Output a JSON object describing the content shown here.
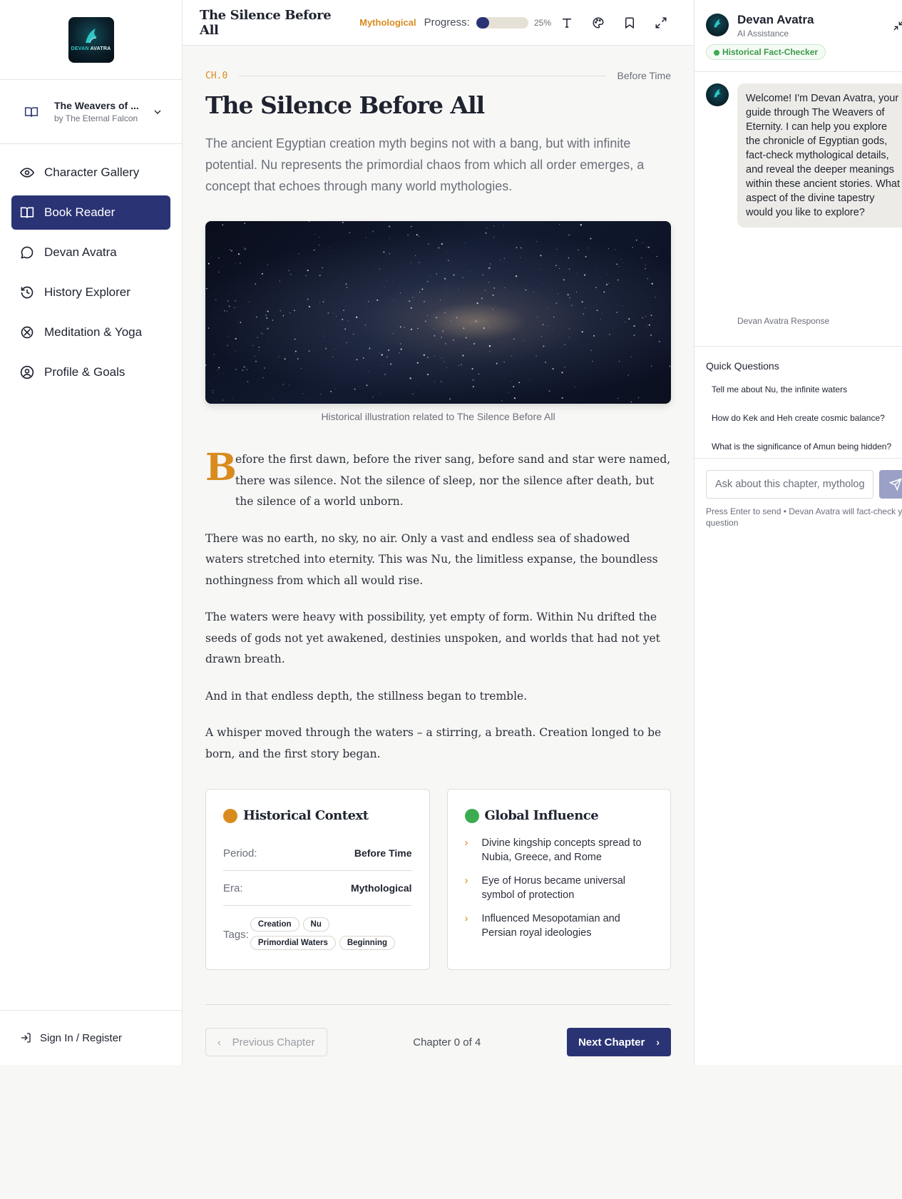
{
  "sidebar": {
    "logo_text_a": "DEVAN",
    "logo_text_b": "AVATRA",
    "book": {
      "title": "The Weavers of ...",
      "author": "by The Eternal Falcon"
    },
    "nav": [
      {
        "label": "Character Gallery",
        "icon": "eye-icon",
        "active": false
      },
      {
        "label": "Book Reader",
        "icon": "book-open-icon",
        "active": true
      },
      {
        "label": "Devan Avatra",
        "icon": "chat-bubble-icon",
        "active": false
      },
      {
        "label": "History Explorer",
        "icon": "history-icon",
        "active": false
      },
      {
        "label": "Meditation & Yoga",
        "icon": "lotus-icon",
        "active": false
      },
      {
        "label": "Profile & Goals",
        "icon": "user-circle-icon",
        "active": false
      }
    ],
    "signin_label": "Sign In / Register"
  },
  "topbar": {
    "title": "The Silence Before All",
    "tag": "Mythological",
    "progress_label": "Progress:",
    "progress_value": 0.25,
    "progress_text": "25%",
    "icons": [
      "text-size-icon",
      "palette-icon",
      "bookmark-icon",
      "fullscreen-icon"
    ]
  },
  "chapter": {
    "number": "CH.0",
    "period": "Before Time",
    "title": "The Silence Before All",
    "intro": "The ancient Egyptian creation myth begins not with a bang, but with infinite potential. Nu represents the primordial chaos from which all order emerges, a concept that echoes through many world mythologies.",
    "image_caption": "Historical illustration related to The Silence Before All",
    "dropcap": "B",
    "paragraph_first": "efore the first dawn, before the river sang, before sand and star were named, there was silence. Not the silence of sleep, nor the silence after death, but the silence of a world unborn.",
    "paragraphs": [
      "There was no earth, no sky, no air. Only a vast and endless sea of shadowed waters stretched into eternity. This was Nu, the limitless expanse, the boundless nothingness from which all would rise.",
      "The waters were heavy with possibility, yet empty of form. Within Nu drifted the seeds of gods not yet awakened, destinies unspoken, and worlds that had not yet drawn breath.",
      "And in that endless depth, the stillness began to tremble.",
      "A whisper moved through the waters – a stirring, a breath. Creation longed to be born, and the first story began."
    ]
  },
  "context_card": {
    "title": "Historical Context",
    "dot_color": "#d98b1f",
    "period_label": "Period:",
    "period_value": "Before Time",
    "era_label": "Era:",
    "era_value": "Mythological",
    "tags_label": "Tags:",
    "tags": [
      "Creation",
      "Nu",
      "Primordial Waters",
      "Beginning"
    ]
  },
  "influence_card": {
    "title": "Global Influence",
    "dot_color": "#3dab4f",
    "items": [
      "Divine kingship concepts spread to Nubia, Greece, and Rome",
      "Eye of Horus became universal symbol of protection",
      "Influenced Mesopotamian and Persian royal ideologies"
    ]
  },
  "pager": {
    "prev_label": "Previous Chapter",
    "count": "Chapter 0 of 4",
    "next_label": "Next Chapter"
  },
  "chat": {
    "name": "Devan Avatra",
    "subtitle": "AI Assistance",
    "badge": "Historical Fact-Checker",
    "welcome": "Welcome! I'm Devan Avatra, your guide through The Weavers of Eternity. I can help you explore the chronicle of Egyptian gods, fact-check mythological details, and reveal the deeper meanings within these ancient stories. What aspect of the divine tapestry would you like to explore?",
    "response_label": "Devan Avatra Response",
    "quick_title": "Quick Questions",
    "quick_questions": [
      "Tell me about Nu, the infinite waters",
      "How do Kek and Heh create cosmic balance?",
      "What is the significance of Amun being hidden?"
    ],
    "input_placeholder": "Ask about this chapter, mythology, or history...",
    "hint": "Press Enter to send • Devan Avatra will fact-check your question"
  },
  "colors": {
    "brand": "#2a3374",
    "accent": "#d98b1f",
    "success": "#3dab4f"
  }
}
